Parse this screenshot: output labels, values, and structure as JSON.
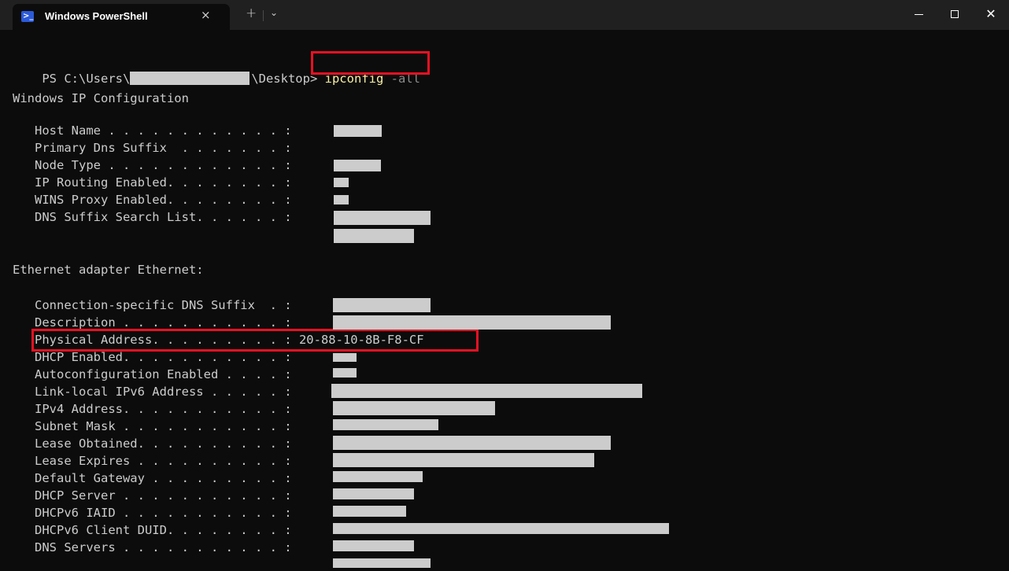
{
  "window": {
    "tab_title": "Windows PowerShell",
    "tab_icon": "powershell-icon",
    "tab_close": "×",
    "new_tab": "+",
    "dropdown": "⌄",
    "minimize_icon": "minimize-icon",
    "maximize_icon": "maximize-icon",
    "close_glyph": "✕"
  },
  "terminal": {
    "prompt_start": "PS C:\\Users\\",
    "prompt_end": "\\Desktop> ",
    "command": "ipconfig",
    "command_arg": " -all",
    "section1_header": "Windows IP Configuration",
    "section1_rows": [
      {
        "label": "   Host Name . . . . . . . . . . . . : ",
        "value": ""
      },
      {
        "label": "   Primary Dns Suffix  . . . . . . . : ",
        "value": ""
      },
      {
        "label": "   Node Type . . . . . . . . . . . . : ",
        "value": ""
      },
      {
        "label": "   IP Routing Enabled. . . . . . . . : ",
        "value": ""
      },
      {
        "label": "   WINS Proxy Enabled. . . . . . . . : ",
        "value": ""
      },
      {
        "label": "   DNS Suffix Search List. . . . . . : ",
        "value": ""
      }
    ],
    "section2_header": "Ethernet adapter Ethernet:",
    "section2_rows": [
      {
        "label": "   Connection-specific DNS Suffix  . : ",
        "value": ""
      },
      {
        "label": "   Description . . . . . . . . . . . : ",
        "value": ""
      },
      {
        "label": "   Physical Address. . . . . . . . . : ",
        "value": "20-88-10-8B-F8-CF"
      },
      {
        "label": "   DHCP Enabled. . . . . . . . . . . : ",
        "value": ""
      },
      {
        "label": "   Autoconfiguration Enabled . . . . : ",
        "value": ""
      },
      {
        "label": "   Link-local IPv6 Address . . . . . : ",
        "value": ""
      },
      {
        "label": "   IPv4 Address. . . . . . . . . . . : ",
        "value": ""
      },
      {
        "label": "   Subnet Mask . . . . . . . . . . . : ",
        "value": ""
      },
      {
        "label": "   Lease Obtained. . . . . . . . . . : ",
        "value": ""
      },
      {
        "label": "   Lease Expires . . . . . . . . . . : ",
        "value": ""
      },
      {
        "label": "   Default Gateway . . . . . . . . . : ",
        "value": ""
      },
      {
        "label": "   DHCP Server . . . . . . . . . . . : ",
        "value": ""
      },
      {
        "label": "   DHCPv6 IAID . . . . . . . . . . . : ",
        "value": ""
      },
      {
        "label": "   DHCPv6 Client DUID. . . . . . . . : ",
        "value": ""
      },
      {
        "label": "   DNS Servers . . . . . . . . . . . : ",
        "value": ""
      }
    ]
  },
  "colors": {
    "background": "#0c0c0c",
    "text": "#cccccc",
    "command": "#f9f1a5",
    "highlight_box": "#e81123",
    "redaction": "#cccccc"
  }
}
